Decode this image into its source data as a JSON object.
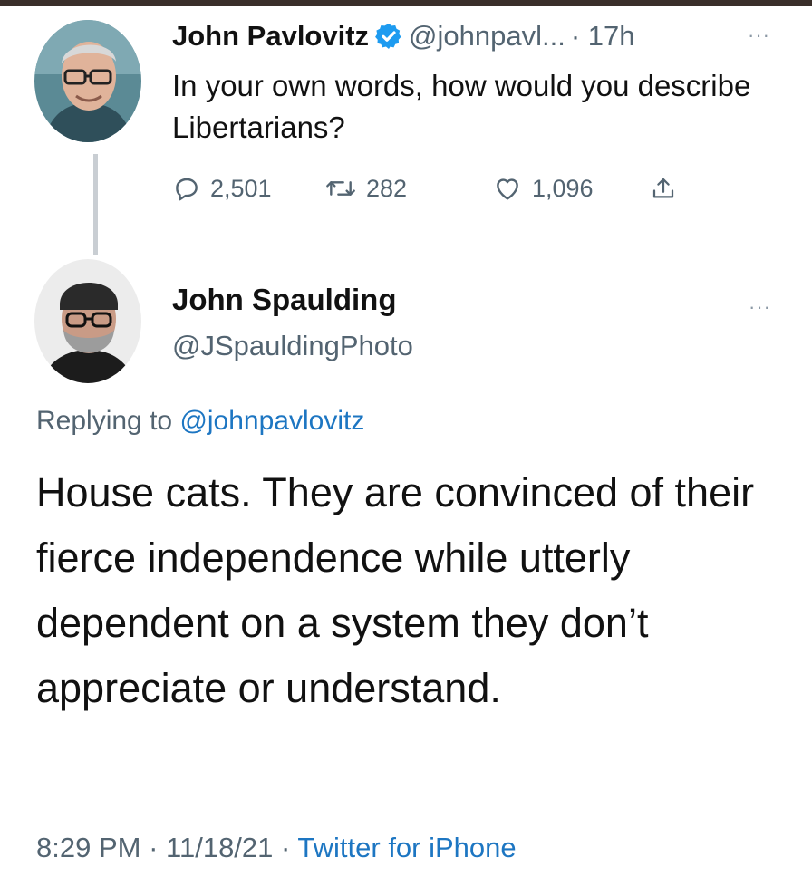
{
  "colors": {
    "text": "#111111",
    "secondary": "#536471",
    "link": "#1d76c2",
    "verified": "#1d9bf0",
    "thread_line": "#c9ced3"
  },
  "parent_tweet": {
    "author_name": "John Pavlovitz",
    "verified_icon": "verified-badge-icon",
    "handle": "@johnpavl...",
    "time": "· 17h",
    "more_icon": "···",
    "text": "In your own words, how would you describe Libertarians?",
    "actions": {
      "reply_count": "2,501",
      "retweet_count": "282",
      "like_count": "1,096"
    }
  },
  "reply_tweet": {
    "author_name": "John Spaulding",
    "handle": "@JSpauldingPhoto",
    "more_icon": "···",
    "replying_prefix": "Replying to",
    "replying_mention": "@johnpavlovitz",
    "text": "House cats. They are convinced of their fierce independence while utterly dependent on a system they don’t appreciate or understand.",
    "time": "8:29 PM",
    "date": "11/18/21",
    "separator": "·",
    "source": "Twitter for iPhone"
  }
}
